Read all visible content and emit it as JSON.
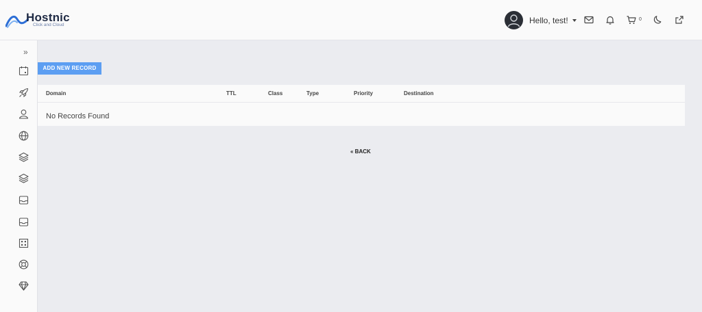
{
  "header": {
    "brand": "Hostnic",
    "tagline": "Click and Cloud",
    "greeting": "Hello, test!",
    "cart_count": "0",
    "icons": [
      "mail-icon",
      "bell-icon",
      "cart-icon",
      "moon-icon",
      "external-link-icon"
    ]
  },
  "sidebar": {
    "toggle": "»",
    "icons": [
      "calendar-icon",
      "rocket-icon",
      "user-icon",
      "globe-icon",
      "layers-icon",
      "layers-icon",
      "inbox-icon",
      "inbox-icon",
      "grid-icon",
      "lifebuoy-icon",
      "diamond-icon"
    ]
  },
  "toolbar": {
    "add_label": "ADD NEW RECORD"
  },
  "table": {
    "columns": [
      "Domain",
      "TTL",
      "Class",
      "Type",
      "Priority",
      "Destination"
    ],
    "empty_text": "No Records Found"
  },
  "nav": {
    "back_label": "« BACK"
  },
  "colors": {
    "accent": "#5c9ef2",
    "background": "#ebecf0",
    "panel": "#fafafa"
  }
}
